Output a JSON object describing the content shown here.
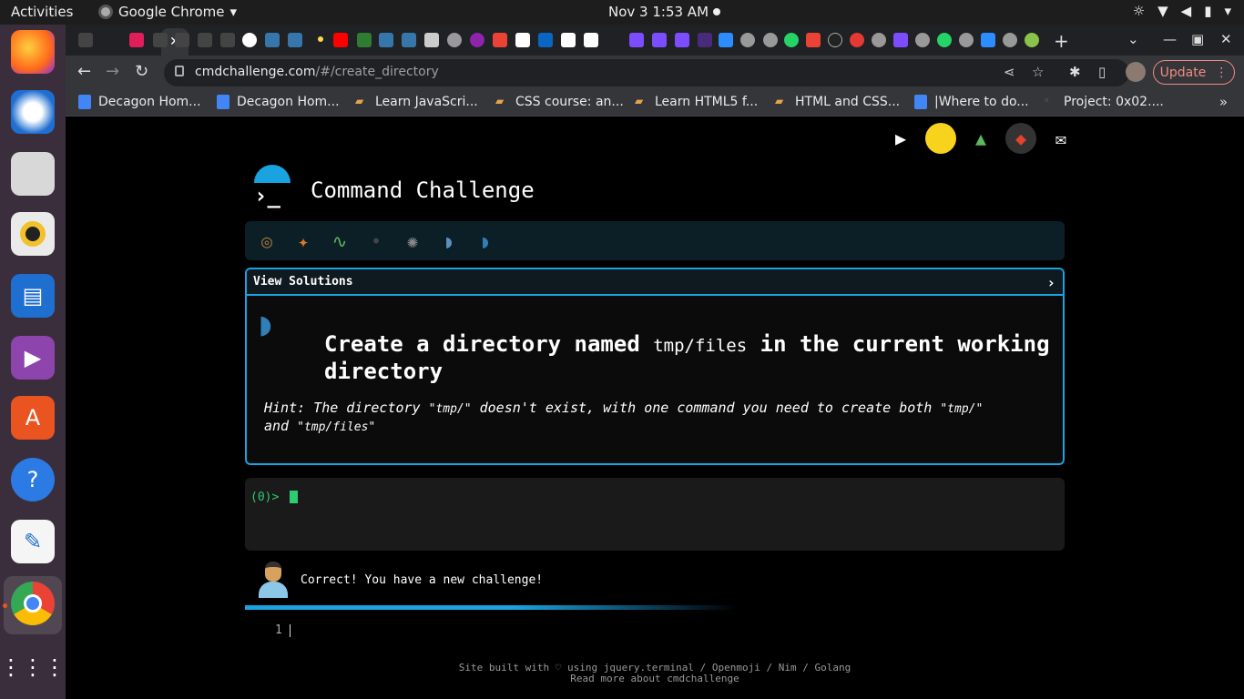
{
  "topbar": {
    "activities": "Activities",
    "app_name": "Google Chrome",
    "clock": "Nov 3  1:53 AM"
  },
  "browser": {
    "url_host": "cmdchallenge.com",
    "url_path": "/#/create_directory",
    "update_label": "Update",
    "bookmarks": [
      "Decagon Hom...",
      "Decagon Hom...",
      "Learn JavaScri...",
      "CSS course: an...",
      "Learn HTML5 f...",
      "HTML and CSS...",
      "|Where to do...",
      "Project: 0x02...."
    ]
  },
  "page": {
    "site_title": "Command Challenge",
    "view_solutions": "View Solutions",
    "chevron": "›",
    "task_before": "Create a directory named ",
    "task_code": "tmp/files",
    "task_after": " in the current working directory",
    "hint_1": "Hint: The directory ",
    "hint_code1": "\"tmp/\"",
    "hint_2": " doesn't exist, with one command you need to create both ",
    "hint_code2": "\"tmp/\"",
    "hint_3": " and ",
    "hint_code3": "\"tmp/files\"",
    "prompt": "(0)>",
    "status_message": "Correct! You have a new challenge!",
    "editor_line": "1",
    "footer_line1": "Site built with ♡ using jquery.terminal / Openmoji / Nim / Golang",
    "footer_line2": "Read more about cmdchallenge"
  },
  "colors": {
    "accent": "#19a3e0",
    "prompt_green": "#2ecc71",
    "update_red": "#f28b82"
  }
}
